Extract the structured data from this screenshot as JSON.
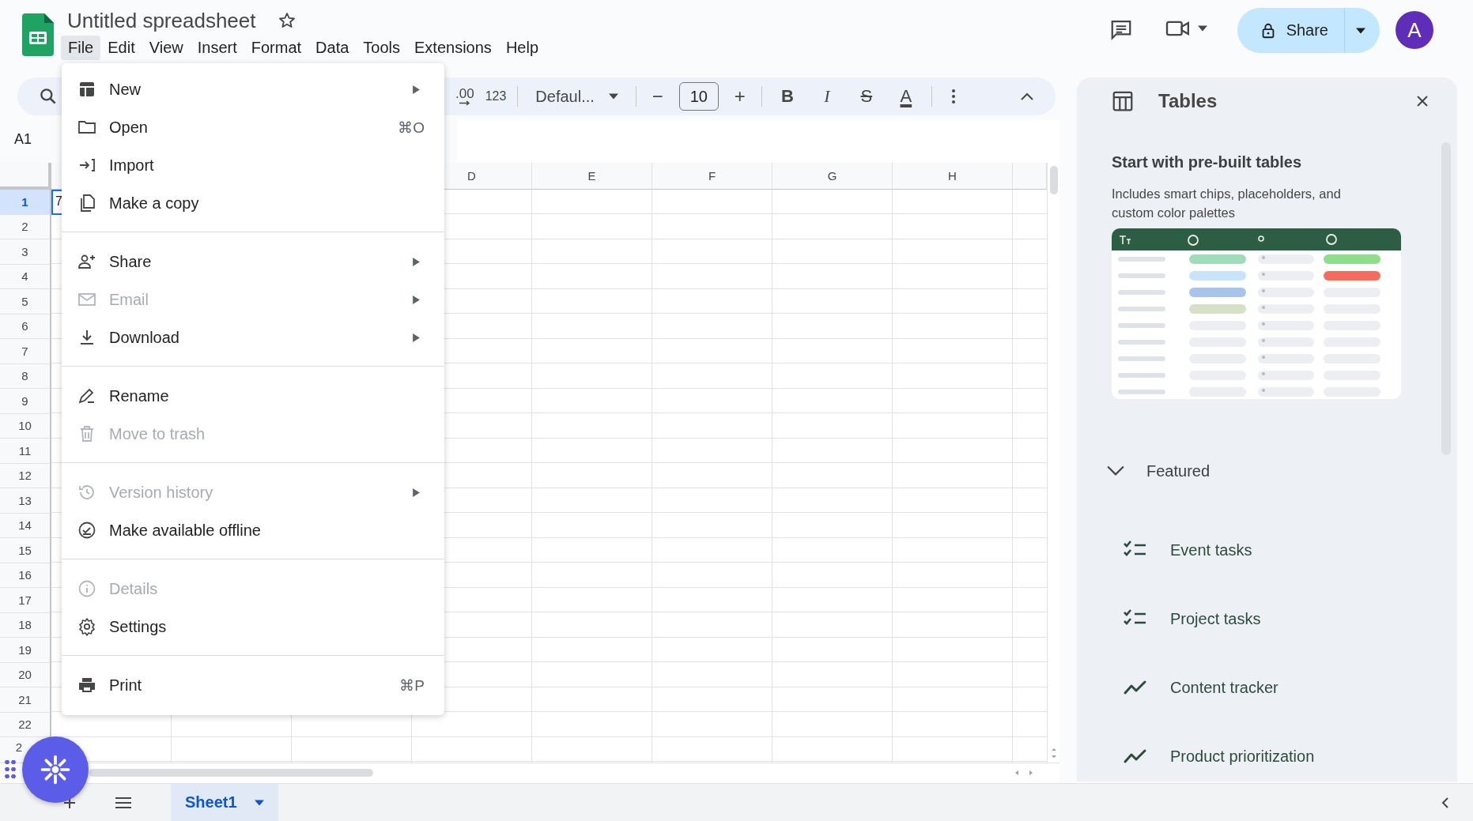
{
  "app": {
    "title": "Untitled spreadsheet",
    "starred": false
  },
  "menu_bar": [
    {
      "label": "File",
      "selected": true
    },
    {
      "label": "Edit",
      "selected": false
    },
    {
      "label": "View",
      "selected": false
    },
    {
      "label": "Insert",
      "selected": false
    },
    {
      "label": "Format",
      "selected": false
    },
    {
      "label": "Data",
      "selected": false
    },
    {
      "label": "Tools",
      "selected": false
    },
    {
      "label": "Extensions",
      "selected": false
    },
    {
      "label": "Help",
      "selected": false
    }
  ],
  "header": {
    "share_label": "Share",
    "avatar": "A"
  },
  "toolbar": {
    "decimal": ".00",
    "number_format": "123",
    "font": "Defaul...",
    "font_size": "10",
    "minus": "−",
    "plus": "+",
    "style_buttons": [
      "B",
      "I",
      "S",
      "A"
    ]
  },
  "name_box": "A1",
  "columns": [
    "D",
    "E",
    "F",
    "G",
    "H"
  ],
  "rows": [
    {
      "label": "1",
      "selected": true
    },
    {
      "label": "2",
      "selected": false
    },
    {
      "label": "3",
      "selected": false
    },
    {
      "label": "4",
      "selected": false
    },
    {
      "label": "5",
      "selected": false
    },
    {
      "label": "6",
      "selected": false
    },
    {
      "label": "7",
      "selected": false
    },
    {
      "label": "8",
      "selected": false
    },
    {
      "label": "9",
      "selected": false
    },
    {
      "label": "10",
      "selected": false
    },
    {
      "label": "11",
      "selected": false
    },
    {
      "label": "12",
      "selected": false
    },
    {
      "label": "13",
      "selected": false
    },
    {
      "label": "14",
      "selected": false
    },
    {
      "label": "15",
      "selected": false
    },
    {
      "label": "16",
      "selected": false
    },
    {
      "label": "17",
      "selected": false
    },
    {
      "label": "18",
      "selected": false
    },
    {
      "label": "19",
      "selected": false
    },
    {
      "label": "20",
      "selected": false
    },
    {
      "label": "21",
      "selected": false
    },
    {
      "label": "22",
      "selected": false
    },
    {
      "label": "2",
      "selected": false
    }
  ],
  "active_cell": {
    "value": "7"
  },
  "file_menu": {
    "groups": [
      [
        {
          "label": "New",
          "submenu": true,
          "disabled": false
        },
        {
          "label": "Open",
          "shortcut": "⌘O",
          "submenu": false,
          "disabled": false
        },
        {
          "label": "Import",
          "submenu": false,
          "disabled": false
        },
        {
          "label": "Make a copy",
          "submenu": false,
          "disabled": false
        }
      ],
      [
        {
          "label": "Share",
          "submenu": true,
          "disabled": false
        },
        {
          "label": "Email",
          "submenu": true,
          "disabled": true
        },
        {
          "label": "Download",
          "submenu": true,
          "disabled": false
        }
      ],
      [
        {
          "label": "Rename",
          "submenu": false,
          "disabled": false
        },
        {
          "label": "Move to trash",
          "submenu": false,
          "disabled": true
        }
      ],
      [
        {
          "label": "Version history",
          "submenu": true,
          "disabled": true
        },
        {
          "label": "Make available offline",
          "submenu": false,
          "disabled": false
        }
      ],
      [
        {
          "label": "Details",
          "submenu": false,
          "disabled": true
        },
        {
          "label": "Settings",
          "submenu": false,
          "disabled": false
        }
      ],
      [
        {
          "label": "Print",
          "shortcut": "⌘P",
          "submenu": false,
          "disabled": false
        }
      ]
    ]
  },
  "side_panel": {
    "title": "Tables",
    "heading": "Start with pre-built tables",
    "description": "Includes smart chips, placeholders, and custom color palettes",
    "section": {
      "label": "Featured",
      "expanded": true
    },
    "items": [
      {
        "label": "Event tasks"
      },
      {
        "label": "Project tasks"
      },
      {
        "label": "Content tracker"
      },
      {
        "label": "Product prioritization"
      }
    ]
  },
  "sheet_tabs": [
    {
      "label": "Sheet1",
      "selected": true
    }
  ]
}
